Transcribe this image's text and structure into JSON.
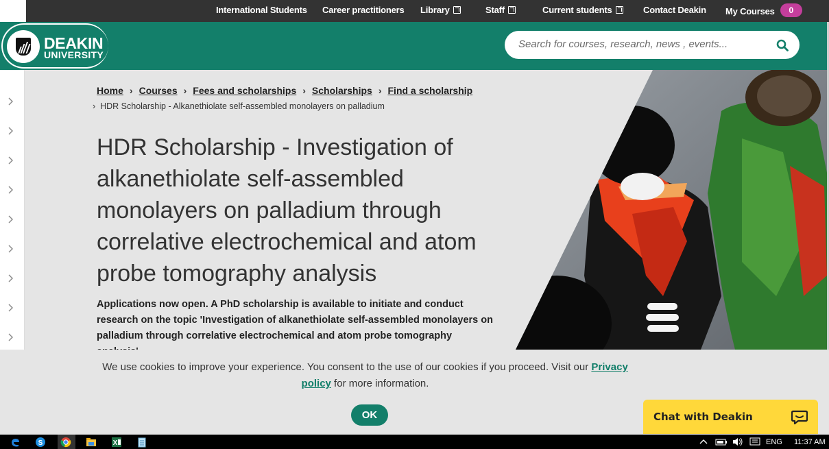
{
  "topnav": {
    "international": "International Students",
    "career": "Career practitioners",
    "library": "Library",
    "staff": "Staff",
    "current": "Current students",
    "contact": "Contact Deakin",
    "my_courses": "My Courses",
    "my_courses_count": "0"
  },
  "logo": {
    "line1": "DEAKIN",
    "line2": "UNIVERSITY"
  },
  "search": {
    "placeholder": "Search for courses, research, news , events..."
  },
  "breadcrumb": {
    "items": [
      "Home",
      "Courses",
      "Fees and scholarships",
      "Scholarships",
      "Find a scholarship"
    ],
    "current": "HDR Scholarship - Alkanethiolate self-assembled monolayers on palladium"
  },
  "page": {
    "title": "HDR Scholarship - Investigation of alkanethiolate self-assembled monolayers on palladium through correlative electrochemical and atom probe tomography analysis",
    "intro": "Applications now open. A PhD scholarship is available to initiate and conduct research on the topic 'Investigation of alkanethiolate self-assembled monolayers on palladium through correlative electrochemical and atom probe tomography analysis'."
  },
  "cookie": {
    "text_before": "We use cookies to improve your experience. You consent to the use of our cookies if you proceed. Visit our ",
    "link": "Privacy policy",
    "text_after": " for more information.",
    "ok": "OK"
  },
  "chat": {
    "label": "Chat with Deakin"
  },
  "taskbar": {
    "lang": "ENG",
    "time": "11:37 AM"
  },
  "colors": {
    "brand": "#137f6a",
    "topbar": "#333333",
    "badge": "#c43e9c",
    "chat": "#ffd83a"
  }
}
